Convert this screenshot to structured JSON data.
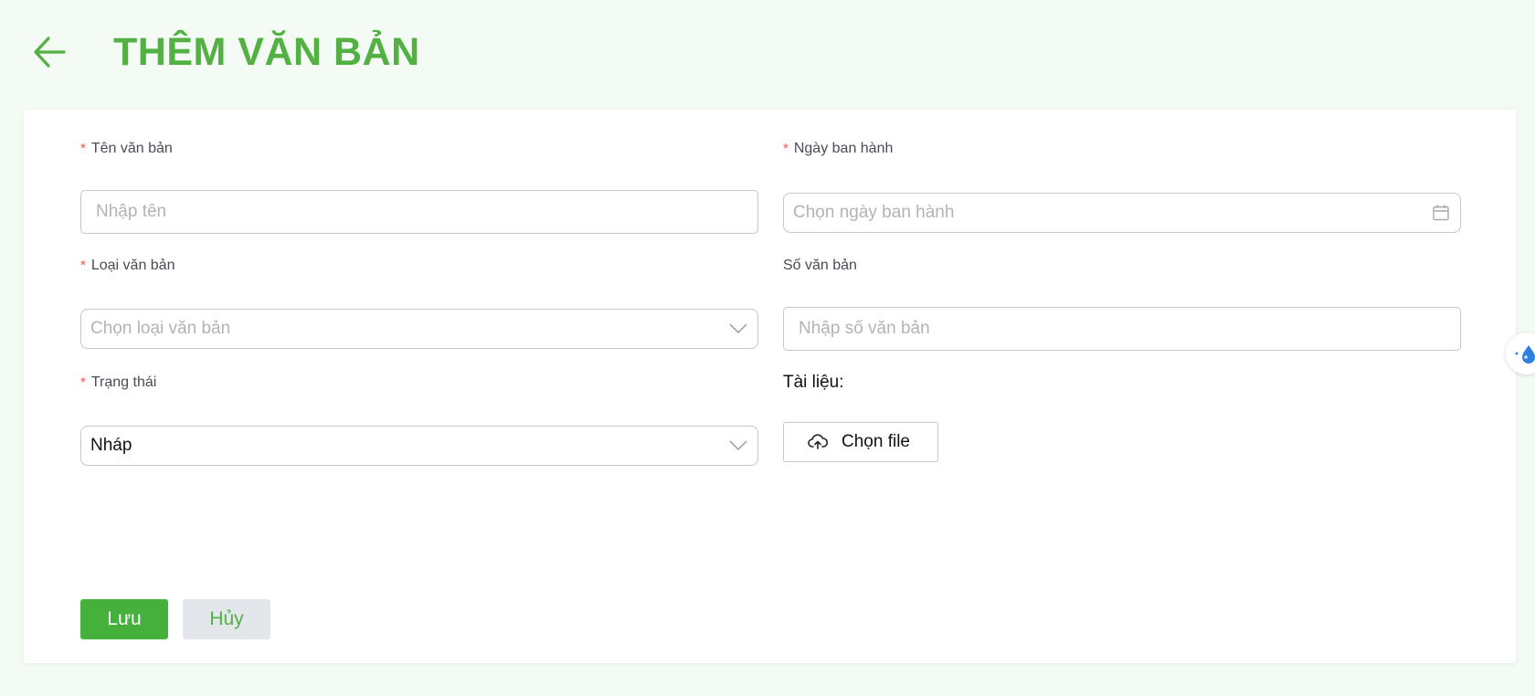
{
  "header": {
    "title": "THÊM VĂN BẢN",
    "back_icon": "arrow-left-icon"
  },
  "form": {
    "name": {
      "label": "Tên văn bản",
      "required": "*",
      "placeholder": "Nhập tên"
    },
    "issue_date": {
      "label": "Ngày ban hành",
      "required": "*",
      "placeholder": "Chọn ngày ban hành",
      "icon": "calendar-icon"
    },
    "doc_type": {
      "label": "Loại văn bản",
      "required": "*",
      "placeholder": "Chọn loại văn bản",
      "icon": "chevron-down-icon"
    },
    "doc_number": {
      "label": "Số văn bản",
      "placeholder": "Nhập số văn bản"
    },
    "status": {
      "label": "Trạng thái",
      "required": "*",
      "value": "Nháp",
      "icon": "chevron-down-icon"
    },
    "attachment": {
      "label": "Tài liệu:",
      "button_label": "Chọn file",
      "icon": "cloud-upload-icon"
    }
  },
  "actions": {
    "save_label": "Lưu",
    "cancel_label": "Hủy"
  },
  "colors": {
    "brand_green": "#52b142",
    "save_bg": "#45b03c",
    "cancel_bg": "#e3e6ea",
    "required": "#ff4d4f",
    "page_bg": "#f4fbf4"
  }
}
